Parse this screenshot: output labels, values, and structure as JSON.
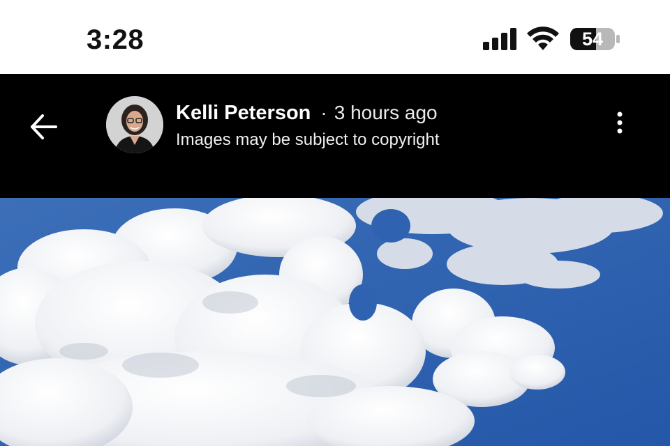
{
  "status_bar": {
    "time": "3:28",
    "battery_level": "54",
    "icons": [
      "cellular-signal-icon",
      "wifi-icon",
      "battery-icon"
    ]
  },
  "header": {
    "back_icon": "back-arrow-icon",
    "author_name": "Kelli Peterson",
    "separator": "·",
    "posted_time": "3 hours ago",
    "copyright_note": "Images may be subject to copyright",
    "more_icon": "more-vertical-icon"
  },
  "colors": {
    "header_background": "#000000",
    "sky_blue": "#2f64b6",
    "cloud_white": "#f2f3f5"
  }
}
